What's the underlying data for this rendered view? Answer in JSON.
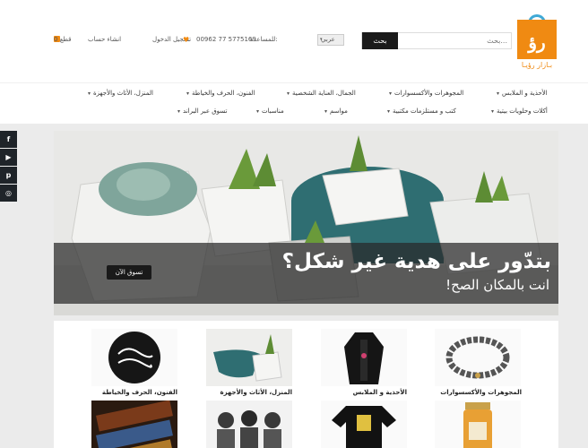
{
  "header": {
    "logo_text": "بـازار رؤيـا",
    "logo_glyph": "رؤ",
    "search": {
      "placeholder": "بحث...",
      "button_label": "بحث"
    },
    "language": "عربي",
    "help_label": "للمساعدة:",
    "phone": "00962 77 5775169",
    "login_label": "تسجيل الدخول",
    "register_label": "انشاء حساب",
    "cart_label": "0 قطع"
  },
  "nav": {
    "row1": [
      "الأحذية و الملابس",
      "المجوهرات والأكسسوارات",
      "الجمال، العناية الشخصية",
      "الفنون، الحرف والخياطة",
      "المنزل، الأثاث والأجهزة"
    ],
    "row2": [
      "أكلات وحلويات بيتية",
      "كتب و مستلزمات مكتبية",
      "مواسم",
      "مناسبات",
      "تسوق عبر البراند"
    ]
  },
  "social": [
    "f",
    "▶",
    "p",
    "◎"
  ],
  "hero": {
    "title": "بتدّور على هدية غير شكل؟",
    "subtitle": "انت بالمكان الصح!",
    "button": "تسوق الآن"
  },
  "categories": [
    {
      "label": "المجوهرات والأكسسوارات"
    },
    {
      "label": "الأحذية و الملابس"
    },
    {
      "label": "المنزل، الأثاث والأجهزة"
    },
    {
      "label": "الفنون، الحرف والخياطة"
    }
  ],
  "colors": {
    "brand_orange": "#f08a12",
    "brand_blue": "#3fa9d6",
    "dark": "#1a1a1a"
  }
}
